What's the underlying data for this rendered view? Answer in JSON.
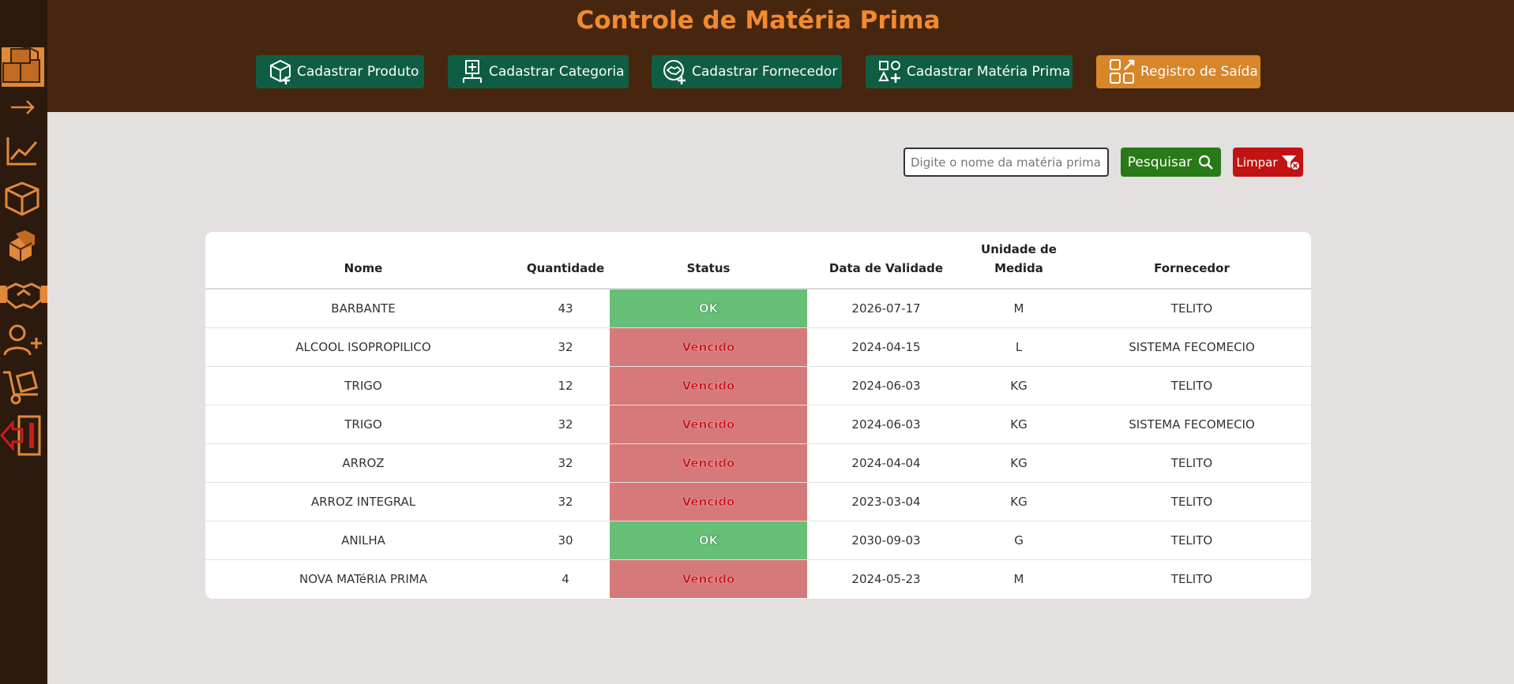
{
  "header": {
    "title": "Controle de Matéria Prima",
    "buttons": [
      {
        "label": "Cadastrar Produto",
        "icon": "box-plus-icon"
      },
      {
        "label": "Cadastrar Categoria",
        "icon": "category-plus-icon"
      },
      {
        "label": "Cadastrar Fornecedor",
        "icon": "handshake-plus-icon"
      },
      {
        "label": "Cadastrar Matéria Prima",
        "icon": "shapes-plus-icon"
      },
      {
        "label": "Registro de Saída",
        "icon": "shapes-exit-icon"
      }
    ]
  },
  "sidebar": {
    "items": [
      "logo-boxes-icon",
      "arrow-right-icon",
      "chart-line-icon",
      "box-icon",
      "boxes-icon",
      "handshake-icon",
      "user-plus-icon",
      "hand-truck-icon",
      "logout-icon"
    ]
  },
  "search": {
    "placeholder": "Digite o nome da matéria prima",
    "value": "",
    "search_label": "Pesquisar",
    "clear_label": "Limpar"
  },
  "table": {
    "headers": {
      "nome": "Nome",
      "quantidade": "Quantidade",
      "status": "Status",
      "validade": "Data de Validade",
      "unidade_1": "Unidade de",
      "unidade_2": "Medida",
      "fornecedor": "Fornecedor"
    },
    "rows": [
      {
        "nome": "BARBANTE",
        "quantidade": "43",
        "status": "OK",
        "validade": "2026-07-17",
        "unidade": "M",
        "fornecedor": "TELITO"
      },
      {
        "nome": "ALCOOL ISOPROPILICO",
        "quantidade": "32",
        "status": "Vencido",
        "validade": "2024-04-15",
        "unidade": "L",
        "fornecedor": "SISTEMA FECOMECIO"
      },
      {
        "nome": "TRIGO",
        "quantidade": "12",
        "status": "Vencido",
        "validade": "2024-06-03",
        "unidade": "KG",
        "fornecedor": "TELITO"
      },
      {
        "nome": "TRIGO",
        "quantidade": "32",
        "status": "Vencido",
        "validade": "2024-06-03",
        "unidade": "KG",
        "fornecedor": "SISTEMA FECOMECIO"
      },
      {
        "nome": "ARROZ",
        "quantidade": "32",
        "status": "Vencido",
        "validade": "2024-04-04",
        "unidade": "KG",
        "fornecedor": "TELITO"
      },
      {
        "nome": "ARROZ INTEGRAL",
        "quantidade": "32",
        "status": "Vencido",
        "validade": "2023-03-04",
        "unidade": "KG",
        "fornecedor": "TELITO"
      },
      {
        "nome": "ANILHA",
        "quantidade": "30",
        "status": "OK",
        "validade": "2030-09-03",
        "unidade": "G",
        "fornecedor": "TELITO"
      },
      {
        "nome": "NOVA MATéRIA PRIMA",
        "quantidade": "4",
        "status": "Vencido",
        "validade": "2024-05-23",
        "unidade": "M",
        "fornecedor": "TELITO"
      }
    ]
  },
  "colors": {
    "sidebar_bg": "#2b1a0d",
    "header_bg": "#472610",
    "accent_orange": "#f38a2c",
    "button_green": "#0f5e43",
    "button_orange": "#d7862a",
    "search_green": "#287a16",
    "clear_red": "#c11313",
    "status_ok": "#66bf76",
    "status_expired": "#d6797a",
    "page_bg": "#e3e0df"
  }
}
